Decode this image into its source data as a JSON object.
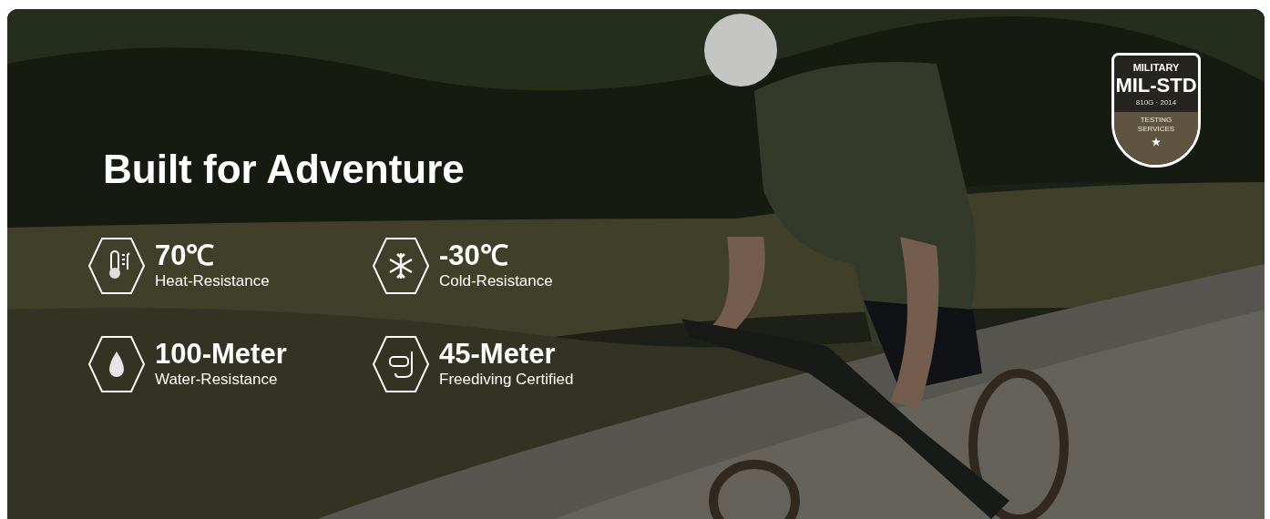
{
  "heading": "Built for Adventure",
  "features": [
    {
      "kind": "heat",
      "value": "70℃",
      "label": "Heat-Resistance"
    },
    {
      "kind": "cold",
      "value": "-30℃",
      "label": "Cold-Resistance"
    },
    {
      "kind": "water",
      "value": "100-Meter",
      "label": "Water-Resistance"
    },
    {
      "kind": "dive",
      "value": "45-Meter",
      "label": "Freediving Certified"
    }
  ],
  "badge": {
    "top": "MILITARY",
    "title": "MIL-STD",
    "subtitle": "810G · 2014",
    "lines": [
      "TESTING",
      "SERVICES"
    ]
  }
}
